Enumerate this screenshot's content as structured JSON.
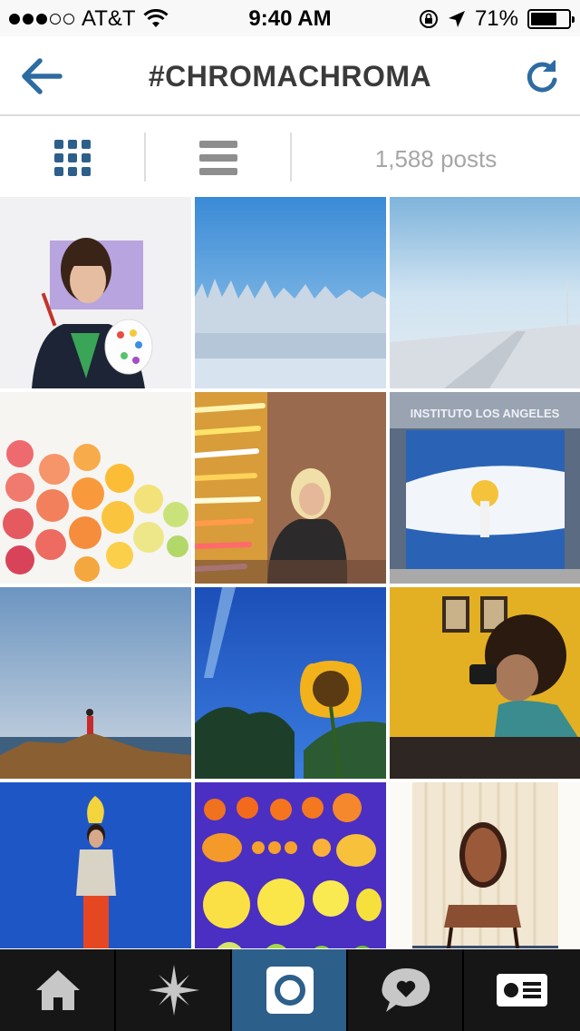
{
  "status_bar": {
    "carrier": "AT&T",
    "time": "9:40 AM",
    "battery_percent": "71%",
    "battery_level": 0.71,
    "signal_bars": 3,
    "signal_total": 5,
    "icons": [
      "wifi-icon",
      "rotation-lock-icon",
      "location-arrow-icon",
      "battery-icon"
    ]
  },
  "header": {
    "title": "#CHROMACHROMA",
    "back_icon": "back-arrow-icon",
    "refresh_icon": "refresh-icon"
  },
  "toolbar": {
    "grid_view_icon": "grid-view-icon",
    "list_view_icon": "list-view-icon",
    "post_count": "1,588 posts"
  },
  "photos": [
    {
      "subject": "woman with paint palette on purple backdrop"
    },
    {
      "subject": "frosted forest under blue sky"
    },
    {
      "subject": "misty winter road"
    },
    {
      "subject": "sliced citrus fruits gradient"
    },
    {
      "subject": "blonde woman with neon light tubes"
    },
    {
      "subject": "Instituto Los Angeles shutter with sun mural"
    },
    {
      "subject": "person on rocky shore by the sea"
    },
    {
      "subject": "sunflower against blue sky"
    },
    {
      "subject": "man with camera in yellow room"
    },
    {
      "subject": "man on blue wall with yellow shape above head"
    },
    {
      "subject": "fruits arranged on purple background"
    },
    {
      "subject": "antique chair by striped wallpaper"
    }
  ],
  "tab_bar": {
    "active_index": 2,
    "tabs": [
      {
        "icon": "home-icon"
      },
      {
        "icon": "explore-star-icon"
      },
      {
        "icon": "camera-icon"
      },
      {
        "icon": "activity-heart-icon"
      },
      {
        "icon": "profile-card-icon"
      }
    ]
  },
  "colors": {
    "accent": "#2d6ca2",
    "tab_active": "#2d5f8b",
    "tab_bar": "#161616"
  }
}
